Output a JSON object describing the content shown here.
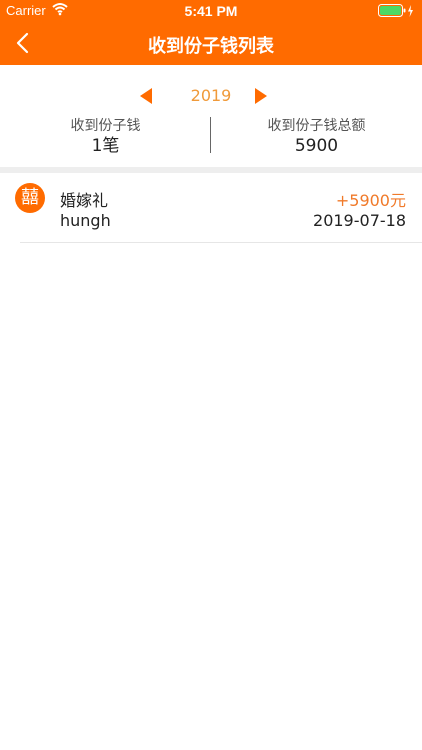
{
  "status_bar": {
    "carrier": "Carrier",
    "time": "5:41 PM"
  },
  "nav": {
    "title": "收到份子钱列表",
    "back_icon": "chevron-left-icon"
  },
  "summary": {
    "year": "2019",
    "count_label": "收到份子钱",
    "count_value": "1笔",
    "total_label": "收到份子钱总额",
    "total_value": "5900"
  },
  "list": {
    "items": [
      {
        "badge": "囍",
        "title": "婚嫁礼",
        "name": "hungh",
        "amount": "+5900元",
        "date": "2019-07-18"
      }
    ]
  },
  "colors": {
    "accent": "#ff6b00",
    "year_text": "#f09a3a",
    "amount_text": "#f07a2a",
    "battery": "#4cd964"
  }
}
